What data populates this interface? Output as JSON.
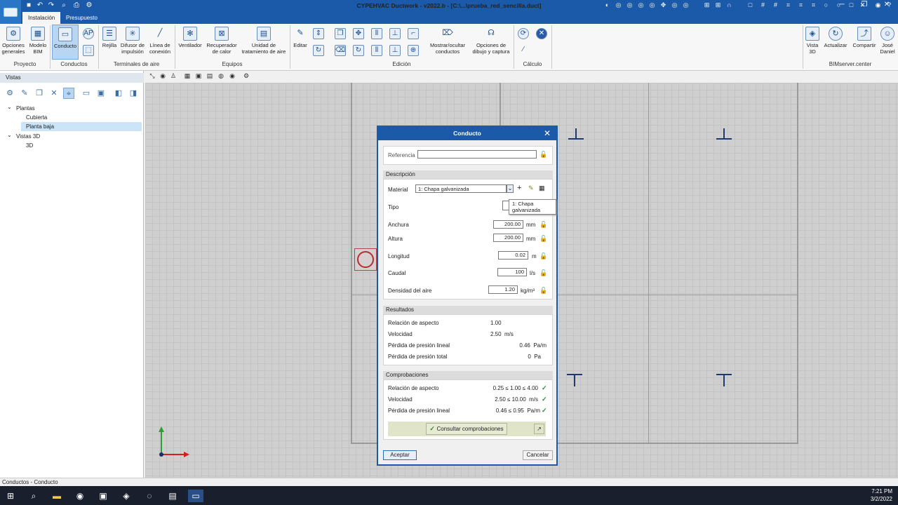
{
  "window": {
    "title": "CYPEHVAC Ductwork - v2022.b - [C:\\...\\prueba_red_sencilla.duct]"
  },
  "tabs": [
    {
      "label": "Instalación"
    },
    {
      "label": "Presupuesto"
    }
  ],
  "ribbon": {
    "groups": [
      {
        "label": "Proyecto"
      },
      {
        "label": "Conductos"
      },
      {
        "label": "Terminales de aire"
      },
      {
        "label": "Equipos"
      },
      {
        "label": "Edición"
      },
      {
        "label": "Cálculo"
      },
      {
        "label": "BIMserver.center"
      }
    ],
    "buttons": {
      "opciones_generales": "Opciones\ngenerales",
      "modelo_bim": "Modelo\nBIM",
      "conducto": "Conducto",
      "rejilla": "Rejilla",
      "difusor": "Difusor de\nimpulsión",
      "linea_conexion": "Línea de\nconexión",
      "ventilador": "Ventilador",
      "recuperador": "Recuperador\nde calor",
      "unidad_tratamiento": "Unidad de\ntratamiento de aire",
      "editar": "Editar",
      "mostrar_ocultar": "Mostrar/ocultar\nconductos",
      "opciones_dibujo": "Opciones de\ndibujo y captura",
      "vista_3d": "Vista\n3D",
      "actualizar": "Actualizar",
      "compartir": "Compartir",
      "user": "José\nDaniel"
    }
  },
  "left_panel": {
    "title": "Vistas",
    "tree": [
      {
        "label": "Plantas"
      },
      {
        "label": "Cubierta"
      },
      {
        "label": "Planta baja"
      },
      {
        "label": "Vistas 3D"
      },
      {
        "label": "3D"
      }
    ]
  },
  "dialog": {
    "title": "Conducto",
    "referencia": {
      "label": "Referencia",
      "value": ""
    },
    "descripcion": {
      "header": "Descripción",
      "material_label": "Material",
      "material_value": "1: Chapa galvanizada",
      "tooltip": "1: Chapa galvanizada",
      "tipo_label": "Tipo",
      "anchura": {
        "label": "Anchura",
        "value": "200.00",
        "unit": "mm"
      },
      "altura": {
        "label": "Altura",
        "value": "200.00",
        "unit": "mm"
      },
      "longitud": {
        "label": "Longitud",
        "value": "0.02",
        "unit": "m"
      },
      "caudal": {
        "label": "Caudal",
        "value": "100",
        "unit": "l/s"
      },
      "densidad": {
        "label": "Densidad del aire",
        "value": "1.20",
        "unit": "kg/m³"
      }
    },
    "resultados": {
      "header": "Resultados",
      "rows": [
        {
          "label": "Relación de aspecto",
          "value": "1.00"
        },
        {
          "label": "Velocidad",
          "value": "2.50  m/s"
        },
        {
          "label": "Pérdida de presión lineal",
          "value": "0.46  Pa/m"
        },
        {
          "label": "Pérdida de presión total",
          "value": "0  Pa"
        }
      ]
    },
    "comprobaciones": {
      "header": "Comprobaciones",
      "rows": [
        {
          "label": "Relación de aspecto",
          "value": "0.25 ≤ 1.00 ≤ 4.00"
        },
        {
          "label": "Velocidad",
          "value": "2.50 ≤ 10.00  m/s"
        },
        {
          "label": "Pérdida de presión lineal",
          "value": "0.46 ≤ 0.95  Pa/m"
        }
      ],
      "button": "Consultar comprobaciones"
    },
    "aceptar": "Aceptar",
    "cancelar": "Cancelar"
  },
  "status": {
    "text": "Conductos - Conducto"
  },
  "clock": {
    "time": "7:21 PM",
    "date": "3/2/2022"
  }
}
